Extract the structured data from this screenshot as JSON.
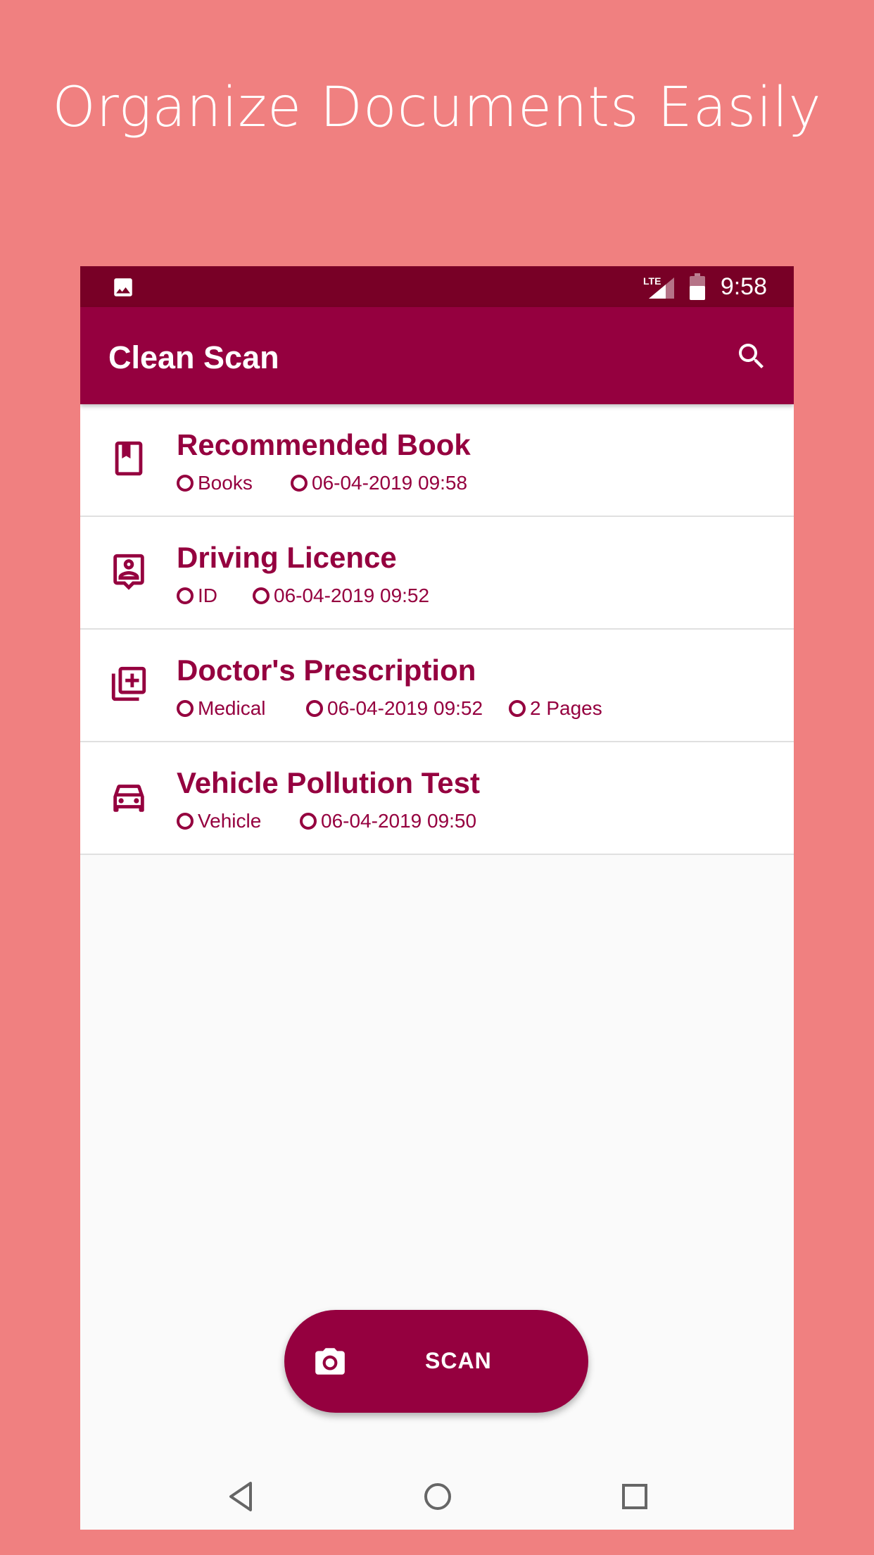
{
  "headline": "Organize Documents Easily",
  "status_bar": {
    "network": "LTE",
    "time": "9:58"
  },
  "app_bar": {
    "title": "Clean Scan",
    "search_icon": "search-icon"
  },
  "documents": [
    {
      "icon": "book-icon",
      "title": "Recommended Book",
      "category": "Books",
      "date": "06-04-2019 09:58",
      "pages": ""
    },
    {
      "icon": "id-card-icon",
      "title": "Driving Licence",
      "category": "ID",
      "date": "06-04-2019 09:52",
      "pages": ""
    },
    {
      "icon": "add-to-library-icon",
      "title": "Doctor's Prescription",
      "category": "Medical",
      "date": "06-04-2019 09:52",
      "pages": "2 Pages"
    },
    {
      "icon": "car-icon",
      "title": "Vehicle Pollution Test",
      "category": "Vehicle",
      "date": "06-04-2019 09:50",
      "pages": ""
    }
  ],
  "fab": {
    "label": "SCAN",
    "icon": "camera-icon"
  },
  "nav": {
    "back": "back-icon",
    "home": "home-icon",
    "recents": "recents-icon"
  },
  "colors": {
    "background": "#F08080",
    "primary": "#95003F",
    "status_bar": "#780026",
    "surface": "#FAFAFA"
  }
}
